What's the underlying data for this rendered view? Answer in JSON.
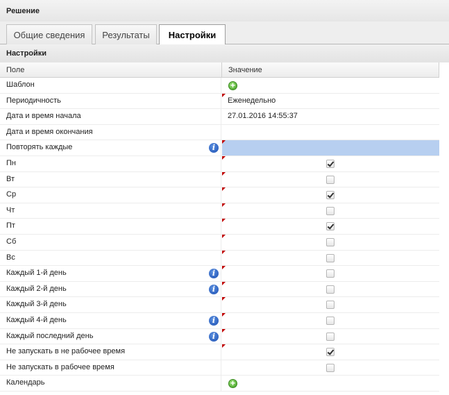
{
  "window": {
    "title": "Решение"
  },
  "tabs": [
    {
      "label": "Общие сведения",
      "active": false
    },
    {
      "label": "Результаты",
      "active": false
    },
    {
      "label": "Настройки",
      "active": true
    }
  ],
  "section": {
    "title": "Настройки"
  },
  "grid": {
    "columns": [
      "Поле",
      "Значение"
    ],
    "rows": [
      {
        "field": "Шаблон",
        "kind": "add"
      },
      {
        "field": "Периодичность",
        "kind": "text",
        "value": "Еженедельно",
        "dirty": true
      },
      {
        "field": "Дата и время начала",
        "kind": "text",
        "value": "27.01.2016 14:55:37"
      },
      {
        "field": "Дата и время окончания",
        "kind": "text",
        "value": ""
      },
      {
        "field": "Повторять каждые",
        "kind": "text",
        "value": "",
        "info": true,
        "dirty": true,
        "selected": true
      },
      {
        "field": "Пн",
        "kind": "check",
        "checked": true,
        "dirty": true
      },
      {
        "field": "Вт",
        "kind": "check",
        "checked": false,
        "dirty": true
      },
      {
        "field": "Ср",
        "kind": "check",
        "checked": true,
        "dirty": true
      },
      {
        "field": "Чт",
        "kind": "check",
        "checked": false,
        "dirty": true
      },
      {
        "field": "Пт",
        "kind": "check",
        "checked": true,
        "dirty": true
      },
      {
        "field": "Сб",
        "kind": "check",
        "checked": false,
        "dirty": true
      },
      {
        "field": "Вс",
        "kind": "check",
        "checked": false,
        "dirty": true
      },
      {
        "field": "Каждый 1-й день",
        "kind": "check",
        "checked": false,
        "info": true,
        "dirty": true
      },
      {
        "field": "Каждый 2-й день",
        "kind": "check",
        "checked": false,
        "info": true,
        "dirty": true
      },
      {
        "field": "Каждый 3-й день",
        "kind": "check",
        "checked": false,
        "dirty": true
      },
      {
        "field": "Каждый 4-й день",
        "kind": "check",
        "checked": false,
        "info": true,
        "dirty": true
      },
      {
        "field": "Каждый последний день",
        "kind": "check",
        "checked": false,
        "info": true,
        "dirty": true
      },
      {
        "field": "Не запускать в не рабочее время",
        "kind": "check",
        "checked": true,
        "dirty": true
      },
      {
        "field": "Не запускать в рабочее время",
        "kind": "check",
        "checked": false
      },
      {
        "field": "Календарь",
        "kind": "add"
      }
    ]
  },
  "icons": {
    "info": "info-icon",
    "add": "add-icon",
    "info_glyph": "i",
    "add_glyph": "+"
  },
  "colors": {
    "selected_row": "#b7cff0",
    "dirty_marker": "#c00000",
    "info_icon": "#1c4fb2",
    "add_icon": "#3f9b22"
  }
}
